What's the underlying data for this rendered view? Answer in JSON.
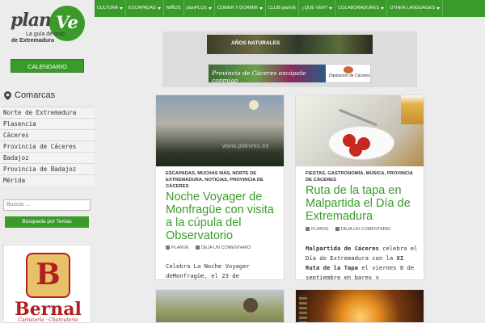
{
  "logo": {
    "plan": "plan",
    "ve": "Ve",
    "tagline1": "La guía de ocio",
    "tagline2": "de Extremadura"
  },
  "sidebar": {
    "calendar_button": "CALENDARIO",
    "comarcas_title": "Comarcas",
    "regions": [
      "Norte de Extremadura",
      "Plasencia",
      "Cáceres",
      "Provincia de Cáceres",
      "Badajoz",
      "Provincia de Badajoz",
      "Mérida"
    ],
    "search_placeholder": "Buscar ...",
    "topic_search_button": "Búsqueda por Temas",
    "ad": {
      "badge": "B",
      "name": "Bernal",
      "sub": "Carnicería · Charcutería"
    }
  },
  "nav": {
    "items": [
      {
        "label": "CULTURA",
        "dropdown": true
      },
      {
        "label": "ESCAPADAS",
        "dropdown": true
      },
      {
        "label": "NIÑOS",
        "dropdown": false
      },
      {
        "label": "planPLUS",
        "dropdown": true
      },
      {
        "label": "COMER Y DORMIR",
        "dropdown": true
      },
      {
        "label": "CLUB planVE",
        "dropdown": false
      },
      {
        "label": "¿QUÉ VER?",
        "dropdown": true
      },
      {
        "label": "COLABORADORES",
        "dropdown": true
      },
      {
        "label": "OTHER LANGUAGES",
        "dropdown": true
      }
    ]
  },
  "banners": {
    "banner1_text": "AÑOS NATURALES",
    "banner2_text": "Provincia de Cáceres escápate conmigo",
    "banner2_brand": "Diputación de Cáceres"
  },
  "posts": [
    {
      "categories": "ESCAPADAS, MUCHAS MÁS, NORTE DE EXTREMADURA, NOTICIAS, PROVINCIA DE CÁCERES",
      "title": "Noche Voyager de Monfragüe con visita a la cúpula del Observatorio",
      "author": "PLANVE",
      "comments": "DEJA UN COMENTARIO",
      "excerpt": "Celebra La Noche Voyager deMonfragüe, el 23 de",
      "watermark": "www.planvex.es"
    },
    {
      "categories": "FIESTAS, GASTRONOMÍA, MÚSICA, PROVINCIA DE CÁCERES",
      "title": "Ruta de la tapa en Malpartida el Día de Extremadura",
      "author": "PLANVE",
      "comments": "DEJA UN COMENTARIO",
      "excerpt_bold1": "Malpartida de Cáceres",
      "excerpt_mid": " celebra el Día de Extremadura con la ",
      "excerpt_bold2": "XI Ruta de la Tapa",
      "excerpt_end": " el viernes 8 de septiembre en bares y"
    }
  ],
  "colors": {
    "brand_green": "#3a9a2a",
    "background": "#ececec"
  }
}
